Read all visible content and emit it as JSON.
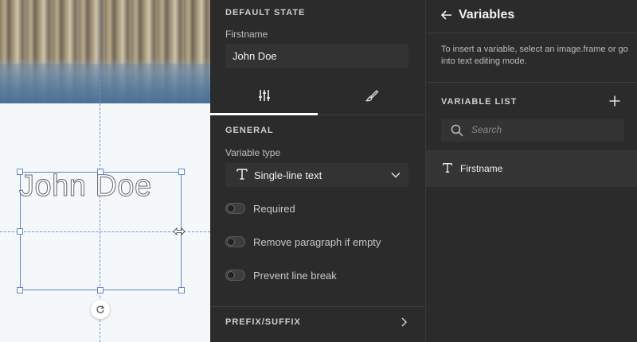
{
  "canvas": {
    "frame_text": "John Doe"
  },
  "middle_panel": {
    "default_state_title": "DEFAULT STATE",
    "firstname_label": "Firstname",
    "firstname_value": "John Doe",
    "tabs": [
      {
        "name": "settings",
        "icon": "sliders-icon",
        "active": true
      },
      {
        "name": "style",
        "icon": "brush-icon",
        "active": false
      }
    ],
    "general_title": "GENERAL",
    "variable_type_label": "Variable type",
    "variable_type_value": "Single-line text",
    "toggles": [
      {
        "label": "Required",
        "on": false
      },
      {
        "label": "Remove paragraph if empty",
        "on": false
      },
      {
        "label": "Prevent line break",
        "on": false
      }
    ],
    "prefix_suffix_title": "PREFIX/SUFFIX"
  },
  "right_panel": {
    "title": "Variables",
    "help_text": "To insert a variable, select an image.frame or go into text editing mode.",
    "variable_list_title": "VARIABLE LIST",
    "search_placeholder": "Search",
    "variables": [
      {
        "label": "Firstname",
        "icon": "text-type-icon"
      }
    ]
  },
  "colors": {
    "panel_bg": "#2b2b2b",
    "input_bg": "#333333",
    "selection_blue": "#5e86d1"
  }
}
